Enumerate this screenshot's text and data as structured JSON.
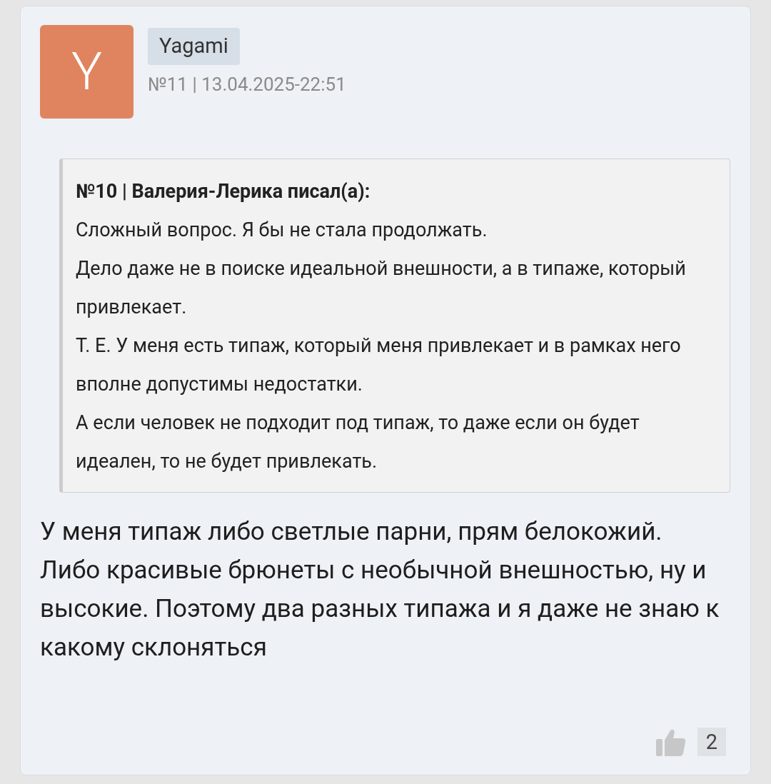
{
  "post": {
    "avatar_letter": "Y",
    "author": "Yagami",
    "meta": "№11 | 13.04.2025-22:51",
    "quote": {
      "header": "№10 | Валерия-Лерика писал(а):",
      "paragraphs": [
        "Сложный вопрос. Я бы не стала продолжать.",
        "Дело даже не в поиске идеальной внешности, а в типаже, который привлекает.",
        "Т. Е. У меня есть типаж, который меня привлекает и в рамках него вполне допустимы недостатки.",
        "А если человек не подходит под типаж, то даже если он будет идеален, то не будет привлекать."
      ]
    },
    "text": "У меня типаж либо светлые парни, прям белокожий. Либо красивые брюнеты с необычной внешностью, ну и высокие. Поэтому два разных типажа и я даже не знаю к какому склоняться",
    "likes": "2"
  }
}
